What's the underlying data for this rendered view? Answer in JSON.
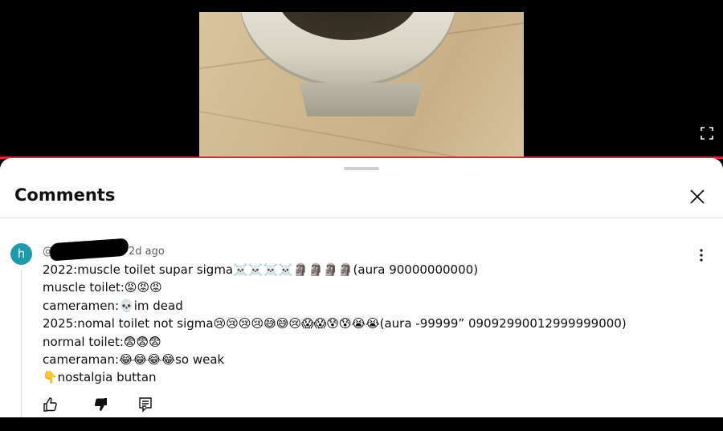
{
  "player": {
    "fullscreen_icon": "fullscreen-icon",
    "progress_color": "#e8223a"
  },
  "comments_panel": {
    "title": "Comments",
    "close_icon": "close-icon",
    "drag_handle_icon": "drag-handle"
  },
  "comment": {
    "avatar_letter": "h",
    "avatar_color": "#1e9aa8",
    "author_prefix": "@",
    "time": "2d ago",
    "lines": [
      "2022:muscle toilet supar sigma☠️☠️☠️☠️🗿🗿🗿🗿(aura 90000000000)",
      "muscle toilet:😡😡😡",
      "cameramen:💀im dead",
      "2025:nomal toilet not sigma😢😢😢😢😅😅😢😱😱😰😰😭😭(aura -99999” 09092990012999999000)",
      "normal toilet:😨😨😨",
      "cameraman:😂😂😂😂so weak",
      "👇nostalgia buttan"
    ],
    "actions": {
      "like_icon": "thumbs-up-icon",
      "dislike_icon": "thumbs-down-icon",
      "reply_icon": "reply-icon"
    },
    "more_icon": "more-vertical-icon"
  }
}
